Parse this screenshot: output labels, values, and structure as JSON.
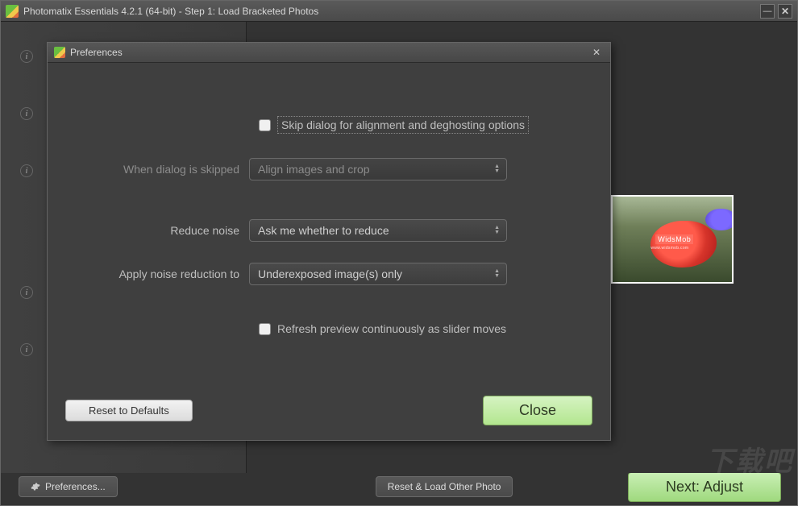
{
  "window": {
    "title": "Photomatix Essentials  4.2.1 (64-bit) - Step 1: Load Bracketed Photos"
  },
  "bottom": {
    "preferences_label": "Preferences...",
    "reset_load_label": "Reset & Load Other Photo",
    "next_label": "Next: Adjust"
  },
  "thumb": {
    "brand": "WidsMob",
    "sub": "www.widsmob.com"
  },
  "dialog": {
    "title": "Preferences",
    "skip_label": "Skip dialog for alignment and deghosting options",
    "when_skipped_label": "When dialog is skipped",
    "when_skipped_value": "Align images and crop",
    "reduce_noise_label": "Reduce noise",
    "reduce_noise_value": "Ask me whether to reduce",
    "apply_nr_label": "Apply noise reduction to",
    "apply_nr_value": "Underexposed image(s) only",
    "refresh_label": "Refresh preview continuously as slider moves",
    "reset_label": "Reset to Defaults",
    "close_label": "Close"
  }
}
